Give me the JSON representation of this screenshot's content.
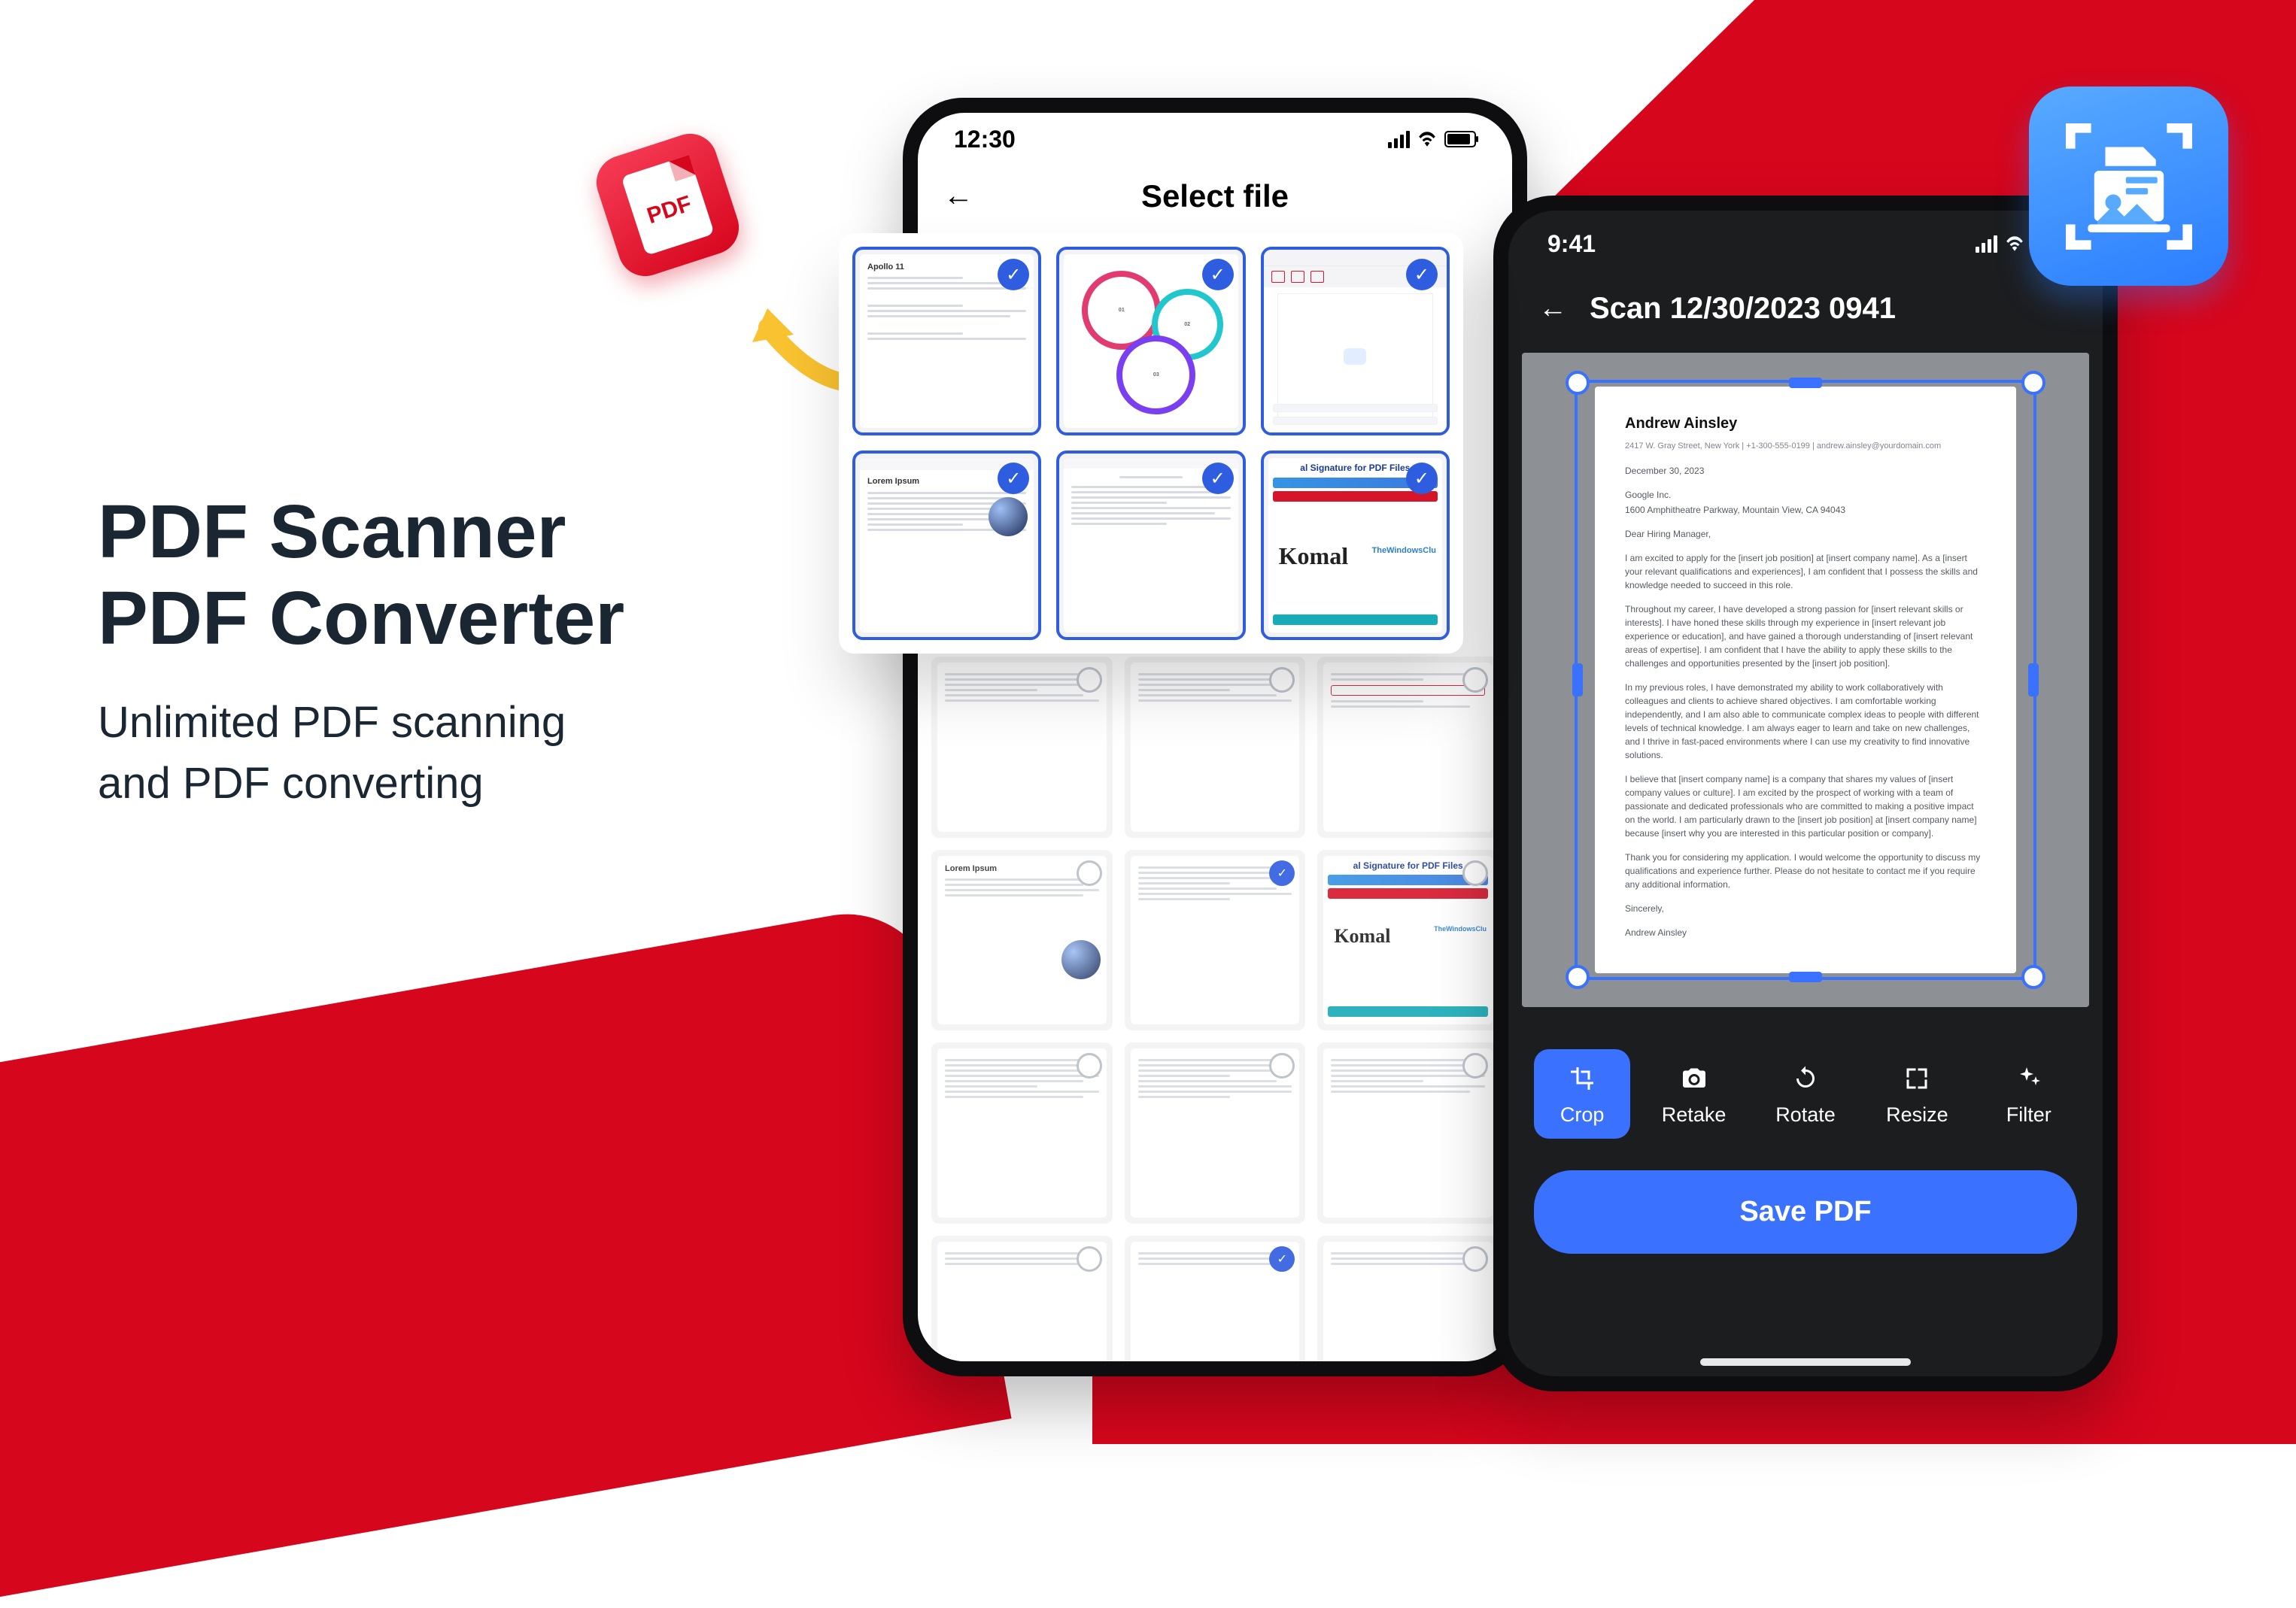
{
  "hero": {
    "title_line1": "PDF Scanner",
    "title_line2": "PDF Converter",
    "subtitle_line1": "Unlimited PDF scanning",
    "subtitle_line2": "and PDF converting"
  },
  "pdf_badge_text": "PDF",
  "phone1": {
    "status_time": "12:30",
    "header_title": "Select file",
    "tiles": {
      "apollo_title": "Apollo 11",
      "lorem_title": "Lorem Ipsum",
      "sig_title": "al Signature for PDF Files",
      "sig_scribble": "Komal",
      "sig_brand": "TheWindowsClu"
    }
  },
  "phone2": {
    "status_time": "9:41",
    "header_title": "Scan 12/30/2023 0941",
    "doc": {
      "name": "Andrew Ainsley",
      "sub": "2417 W. Gray Street, New York | +1-300-555-0199 | andrew.ainsley@yourdomain.com",
      "date": "December 30, 2023",
      "co": "Google Inc.",
      "addr": "1600 Amphitheatre Parkway, Mountain View, CA 94043",
      "greet": "Dear Hiring Manager,",
      "p1": "I am excited to apply for the [insert job position] at [insert company name]. As a [insert your relevant qualifications and experiences], I am confident that I possess the skills and knowledge needed to succeed in this role.",
      "p2": "Throughout my career, I have developed a strong passion for [insert relevant skills or interests]. I have honed these skills through my experience in [insert relevant job experience or education], and have gained a thorough understanding of [insert relevant areas of expertise]. I am confident that I have the ability to apply these skills to the challenges and opportunities presented by the [insert job position].",
      "p3": "In my previous roles, I have demonstrated my ability to work collaboratively with colleagues and clients to achieve shared objectives. I am comfortable working independently, and I am also able to communicate complex ideas to people with different levels of technical knowledge. I am always eager to learn and take on new challenges, and I thrive in fast-paced environments where I can use my creativity to find innovative solutions.",
      "p4": "I believe that [insert company name] is a company that shares my values of [insert company values or culture]. I am excited by the prospect of working with a team of passionate and dedicated professionals who are committed to making a positive impact on the world. I am particularly drawn to the [insert job position] at [insert company name] because [insert why you are interested in this particular position or company].",
      "p5": "Thank you for considering my application. I would welcome the opportunity to discuss my qualifications and experience further. Please do not hesitate to contact me if you require any additional information.",
      "sign1": "Sincerely,",
      "sign2": "Andrew Ainsley"
    },
    "tools": {
      "crop": "Crop",
      "retake": "Retake",
      "rotate": "Rotate",
      "resize": "Resize",
      "filter": "Filter"
    },
    "save_label": "Save PDF"
  }
}
